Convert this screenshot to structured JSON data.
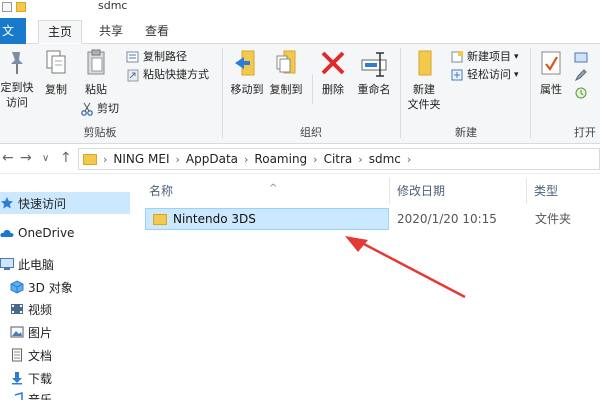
{
  "window": {
    "title": "sdmc"
  },
  "tabs": {
    "file": "文",
    "home": "主页",
    "share": "共享",
    "view": "查看"
  },
  "ribbon": {
    "clipboard": {
      "pin_label_1": "定到快",
      "pin_label_2": "访问",
      "copy_label": "复制",
      "paste_label": "粘贴",
      "copy_path_label": "复制路径",
      "paste_shortcut_label": "粘贴快捷方式",
      "cut_label": "剪切",
      "group_label": "剪贴板"
    },
    "organize": {
      "move_to_label": "移动到",
      "copy_to_label": "复制到",
      "delete_label": "删除",
      "rename_label": "重命名",
      "group_label": "组织"
    },
    "new": {
      "new_item_label": "新建项目",
      "easy_access_label": "轻松访问",
      "new_folder_label_1": "新建",
      "new_folder_label_2": "文件夹",
      "group_label": "新建"
    },
    "open": {
      "properties_label": "属性",
      "group_label": "打开"
    }
  },
  "address": {
    "crumbs": [
      "NING MEI",
      "AppData",
      "Roaming",
      "Citra",
      "sdmc"
    ]
  },
  "nav_pane": {
    "items": [
      {
        "label": "快速访问",
        "icon": "star-icon"
      },
      {
        "label": "OneDrive",
        "icon": "cloud-icon"
      },
      {
        "label": "此电脑",
        "icon": "computer-icon"
      },
      {
        "label": "3D 对象",
        "icon": "cube-icon"
      },
      {
        "label": "视频",
        "icon": "video-icon"
      },
      {
        "label": "图片",
        "icon": "picture-icon"
      },
      {
        "label": "文档",
        "icon": "document-icon"
      },
      {
        "label": "下载",
        "icon": "download-icon"
      },
      {
        "label": "音乐",
        "icon": "music-icon"
      }
    ]
  },
  "columns": {
    "name": "名称",
    "date": "修改日期",
    "type": "类型"
  },
  "files": [
    {
      "name": "Nintendo 3DS",
      "date": "2020/1/20 10:15",
      "type": "文件夹"
    }
  ],
  "colors": {
    "accent": "#1979ca",
    "selection": "#cce8ff",
    "folder": "#f2c94c",
    "annotation_arrow": "#e53935"
  }
}
